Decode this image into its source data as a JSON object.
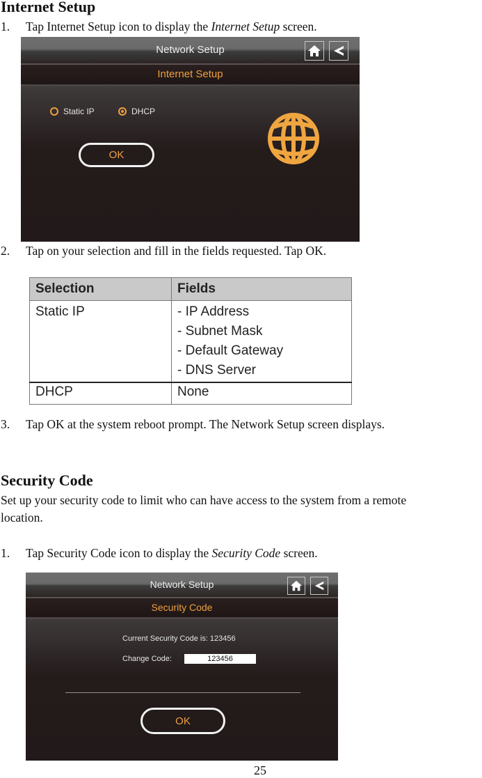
{
  "internet_setup": {
    "heading": "Internet Setup",
    "step1": {
      "num": "1.",
      "pre": "Tap Internet Setup icon to display the ",
      "em": "Internet Setup",
      "post": " screen."
    },
    "screen": {
      "title": "Network Setup",
      "subtitle": "Internet Setup",
      "home_icon": "home-icon",
      "back_icon": "back-arrow-icon",
      "options": [
        {
          "label": "Static IP",
          "selected": false
        },
        {
          "label": "DHCP",
          "selected": true
        }
      ],
      "globe_icon": "globe-icon",
      "ok_label": "OK"
    },
    "step2": {
      "num": "2.",
      "text": "Tap on your selection and fill in the fields requested. Tap OK."
    },
    "table": {
      "headers": [
        "Selection",
        "Fields"
      ],
      "rows": [
        {
          "selection": "Static IP",
          "fields": [
            "- IP Address",
            "- Subnet Mask",
            "- Default Gateway",
            "- DNS Server"
          ]
        },
        {
          "selection": "DHCP",
          "fields": [
            "None"
          ]
        }
      ]
    },
    "step3": {
      "num": "3.",
      "text": "Tap OK at the system reboot prompt. The Network Setup screen displays."
    }
  },
  "security_code": {
    "heading": "Security Code",
    "intro_line1": "Set up your security code to limit who can have access to the system from a remote",
    "intro_line2": "location.",
    "step1": {
      "num": "1.",
      "pre": "Tap Security Code icon to display the ",
      "em": "Security Code",
      "post": " screen."
    },
    "screen": {
      "title": "Network Setup",
      "subtitle": "Security Code",
      "current_code_label": "Current Security Code is: 123456",
      "change_code_label": "Change Code:",
      "change_code_value": "123456",
      "ok_label": "OK"
    }
  },
  "page_number": "25",
  "colors": {
    "accent": "#f0a040",
    "screen_bg": "#221a1a"
  }
}
